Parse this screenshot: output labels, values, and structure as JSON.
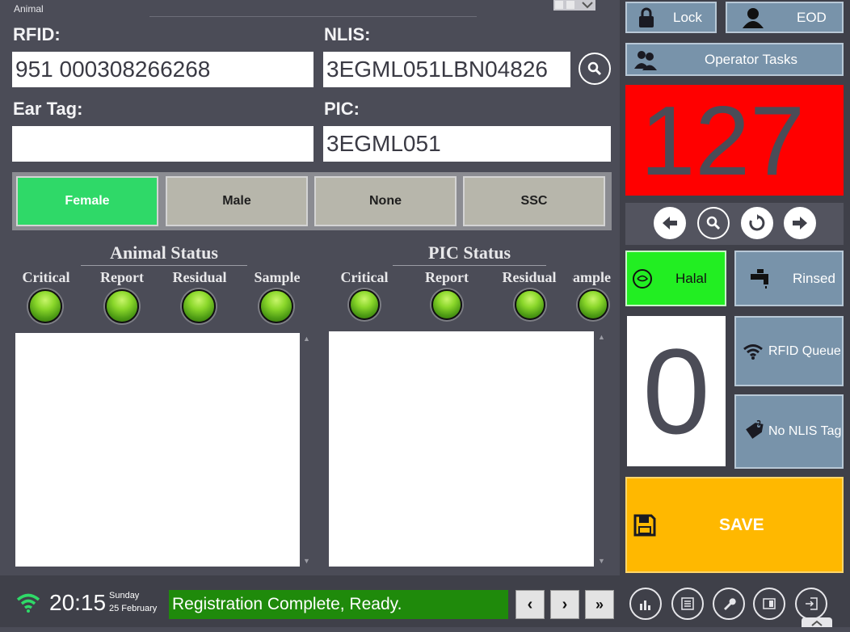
{
  "window": {
    "title": "Animal"
  },
  "fields": {
    "rfid": {
      "label": "RFID:",
      "value": "951 000308266268"
    },
    "nlis": {
      "label": "NLIS:",
      "value": "3EGML051LBN04826"
    },
    "ear_tag": {
      "label": "Ear Tag:",
      "value": ""
    },
    "pic": {
      "label": "PIC:",
      "value": "3EGML051"
    }
  },
  "sex_options": [
    {
      "label": "Female",
      "selected": true
    },
    {
      "label": "Male",
      "selected": false
    },
    {
      "label": "None",
      "selected": false
    },
    {
      "label": "SSC",
      "selected": false
    }
  ],
  "animal_status": {
    "title": "Animal Status",
    "indicators": [
      "Critical",
      "Report",
      "Residual",
      "Sample"
    ]
  },
  "pic_status": {
    "title": "PIC Status",
    "indicators": [
      "Critical",
      "Report",
      "Residual",
      "Sample"
    ]
  },
  "toolbar": {
    "lock_label": "Lock",
    "eod_label": "EOD",
    "operator_tasks_label": "Operator Tasks"
  },
  "counter": {
    "value": "127",
    "bg_color": "#ff0000"
  },
  "tiles": {
    "halal_label": "Halal",
    "rinsed_label": "Rinsed",
    "rfid_queue_label": "RFID Queue",
    "no_nlis_tag_label": "No NLIS Tag",
    "queue_count": "0",
    "save_label": "SAVE"
  },
  "status_bar": {
    "time": "20:15",
    "day": "Sunday",
    "date": "25 February",
    "message": "Registration Complete, Ready."
  },
  "colors": {
    "accent_green": "#2fd968",
    "halal_green": "#22ee22",
    "save_amber": "#ffb800",
    "tile_blue": "#7893aa",
    "message_green": "#1f8a0b"
  },
  "icons": {
    "lock": "padlock-icon",
    "eod": "person-icon",
    "operator_tasks": "group-icon",
    "rinsed": "tap-icon",
    "rfid_queue": "wifi-icon",
    "no_nlis_tag": "tag-icon",
    "save": "floppy-disk-icon"
  }
}
